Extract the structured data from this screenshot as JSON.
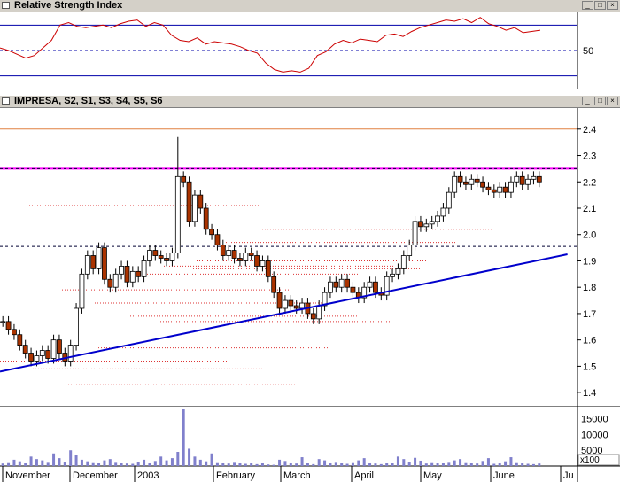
{
  "rsi_panel": {
    "title": "Relative Strength Index"
  },
  "price_panel": {
    "title": "IMPRESA, S2, S1, S3, S4, S5, S6"
  },
  "window_buttons": {
    "minimize": "_",
    "maximize": "□",
    "close": "×"
  },
  "colors": {
    "background": "#ffffff",
    "titlebar": "#d4d0c8",
    "rsi_line": "#cc0000",
    "rsi_band": "#0000aa",
    "up_candle": "#ffffff",
    "down_candle": "#aa3300",
    "trendline": "#0000cc",
    "resistance": "#ff00ff",
    "support_dots": "#dd3333",
    "volume": "#8080cc",
    "orange_line": "#e08040"
  },
  "chart_data": [
    {
      "type": "line",
      "name": "rsi",
      "y_tick_labels": [
        "50"
      ],
      "bands": [
        70,
        50,
        30
      ],
      "ylim": [
        20,
        80
      ],
      "values": [
        52,
        50,
        47,
        44,
        46,
        52,
        58,
        70,
        72,
        69,
        68,
        69,
        70,
        68,
        71,
        73,
        74,
        69,
        72,
        70,
        62,
        58,
        57,
        60,
        55,
        57,
        56,
        55,
        53,
        50,
        48,
        40,
        35,
        33,
        34,
        33,
        36,
        46,
        49,
        55,
        58,
        56,
        59,
        58,
        57,
        62,
        63,
        61,
        65,
        68,
        70,
        72,
        74,
        73,
        75,
        72,
        76,
        71,
        69,
        66,
        68,
        64,
        65,
        66
      ],
      "grid": false
    },
    {
      "type": "candlestick",
      "name": "IMPRESA",
      "ylim": [
        1.35,
        2.48
      ],
      "y_tick_labels": [
        "2.4",
        "2.3",
        "2.2",
        "2.1",
        "2.0",
        "1.9",
        "1.8",
        "1.7",
        "1.6",
        "1.5",
        "1.4"
      ],
      "y_ticks": [
        2.4,
        2.3,
        2.2,
        2.1,
        2.0,
        1.9,
        1.8,
        1.7,
        1.6,
        1.5,
        1.4
      ],
      "x_tick_labels": [
        "November",
        "December",
        "2003",
        "February",
        "March",
        "April",
        "May",
        "June",
        "Ju"
      ],
      "closes": [
        1.67,
        1.64,
        1.62,
        1.58,
        1.55,
        1.52,
        1.54,
        1.56,
        1.53,
        1.6,
        1.55,
        1.52,
        1.58,
        1.72,
        1.85,
        1.92,
        1.87,
        1.95,
        1.83,
        1.8,
        1.85,
        1.88,
        1.82,
        1.86,
        1.84,
        1.9,
        1.94,
        1.92,
        1.91,
        1.9,
        1.93,
        2.22,
        2.2,
        2.05,
        2.15,
        2.1,
        2.02,
        2.0,
        1.96,
        1.92,
        1.94,
        1.91,
        1.9,
        1.93,
        1.92,
        1.88,
        1.9,
        1.84,
        1.78,
        1.72,
        1.75,
        1.73,
        1.72,
        1.74,
        1.7,
        1.68,
        1.73,
        1.78,
        1.82,
        1.8,
        1.83,
        1.8,
        1.78,
        1.76,
        1.8,
        1.82,
        1.78,
        1.77,
        1.84,
        1.85,
        1.87,
        1.92,
        1.96,
        2.05,
        2.03,
        2.04,
        2.05,
        2.07,
        2.1,
        2.16,
        2.22,
        2.2,
        2.19,
        2.21,
        2.2,
        2.18,
        2.17,
        2.16,
        2.18,
        2.16,
        2.2,
        2.22,
        2.19,
        2.21,
        2.22,
        2.2
      ],
      "high_spike": 2.37,
      "resistance": 2.25,
      "upper_line": 2.4,
      "dashed_levels": [
        1.955,
        2.25
      ],
      "trendline": [
        [
          0,
          1.48
        ],
        [
          95,
          1.925
        ]
      ],
      "dotted_levels": [
        1.52,
        1.49,
        1.43,
        1.57,
        1.85,
        1.88,
        1.9,
        1.93,
        2.02,
        2.11,
        1.79,
        1.74,
        1.69,
        1.67,
        1.87,
        1.97
      ],
      "grid": false
    },
    {
      "type": "bar",
      "name": "volume",
      "y_tick_labels": [
        "15000",
        "10000",
        "5000"
      ],
      "y_ticks": [
        15000,
        10000,
        5000
      ],
      "unit_label": "x100",
      "ylim": [
        0,
        18000
      ],
      "values": [
        800,
        1200,
        2000,
        1500,
        900,
        3000,
        2200,
        1800,
        1300,
        4000,
        2500,
        1400,
        5000,
        3500,
        2000,
        1500,
        1200,
        900,
        1800,
        2200,
        1300,
        1000,
        800,
        700,
        1400,
        2000,
        1100,
        1600,
        3000,
        1800,
        2500,
        4500,
        18000,
        5500,
        3000,
        2000,
        1500,
        4000,
        1200,
        900,
        800,
        1300,
        1000,
        700,
        1100,
        600,
        900,
        500,
        400,
        2000,
        1600,
        1000,
        800,
        2800,
        900,
        600,
        2200,
        1800,
        1000,
        1300,
        900,
        700,
        1200,
        1800,
        2500,
        900,
        800,
        600,
        1100,
        1000,
        3000,
        2200,
        1400,
        2600,
        1700,
        800,
        1200,
        1000,
        900,
        1300,
        1800,
        2200,
        1200,
        1000,
        800,
        1600,
        2500,
        700,
        900,
        1500,
        2800,
        1200,
        900,
        700,
        600,
        800
      ]
    }
  ]
}
